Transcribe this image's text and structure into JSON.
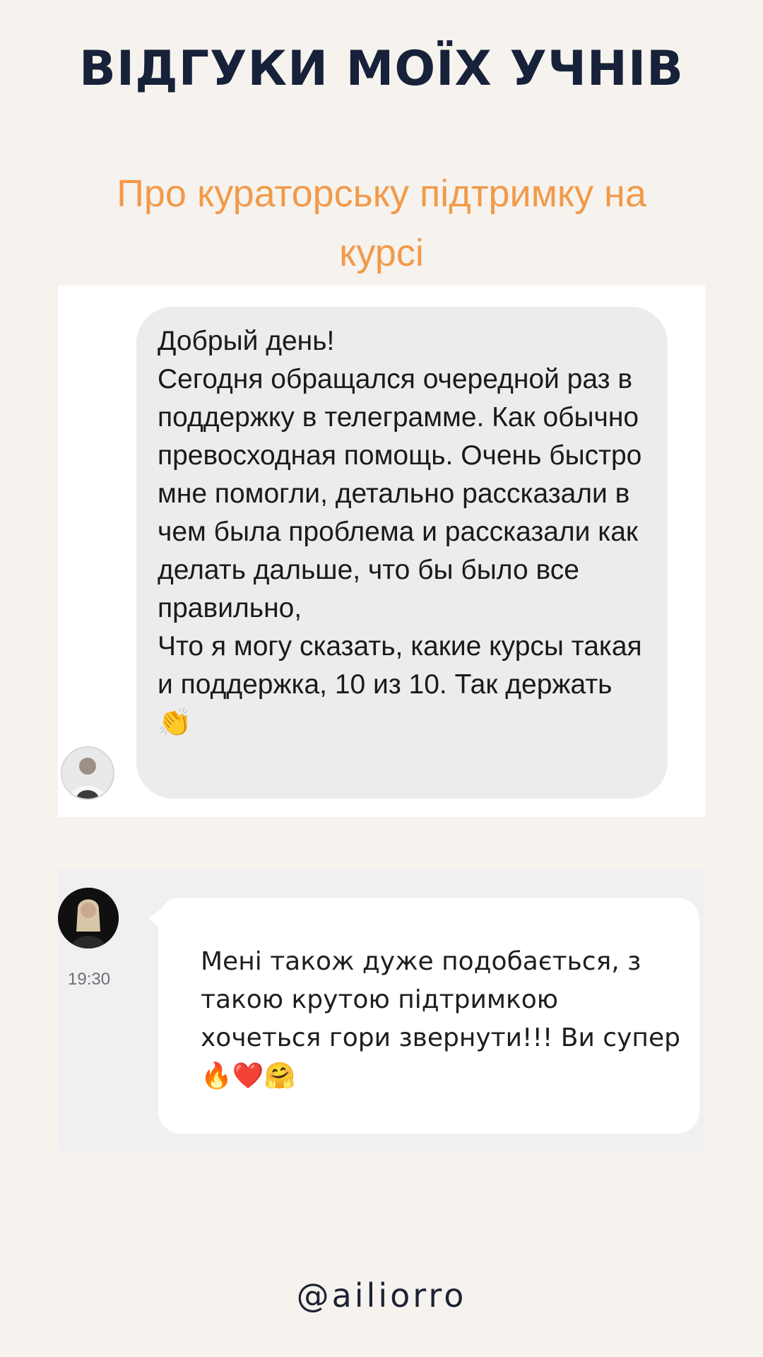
{
  "header": {
    "title": "ВІДГУКИ МОЇХ УЧНІВ"
  },
  "review_1": {
    "heading": "Про кураторську підтримку на курсі",
    "message": "Добрый день!\nСегодня обращался очередной раз в поддержку в телеграмме. Как обычно превосходная помощь. Очень быстро мне помогли, детально рассказали в чем была проблема и рассказали как делать дальше, что бы было все правильно,\nЧто я могу сказать, какие курсы такая и поддержка, 10 из 10. Так держать 👏"
  },
  "review_2": {
    "time": "19:30",
    "message": "Мені також дуже подобається, з такою крутою підтримкою хочеться гори звернути!!! Ви супер🔥❤️🤗"
  },
  "footer": {
    "handle": "@ailiorro"
  },
  "colors": {
    "background": "#f6f3ee",
    "title": "#17213a",
    "heading_accent": "#f29a4a",
    "incoming_bubble": "#ececec",
    "chat_background": "#f0f0f2"
  }
}
